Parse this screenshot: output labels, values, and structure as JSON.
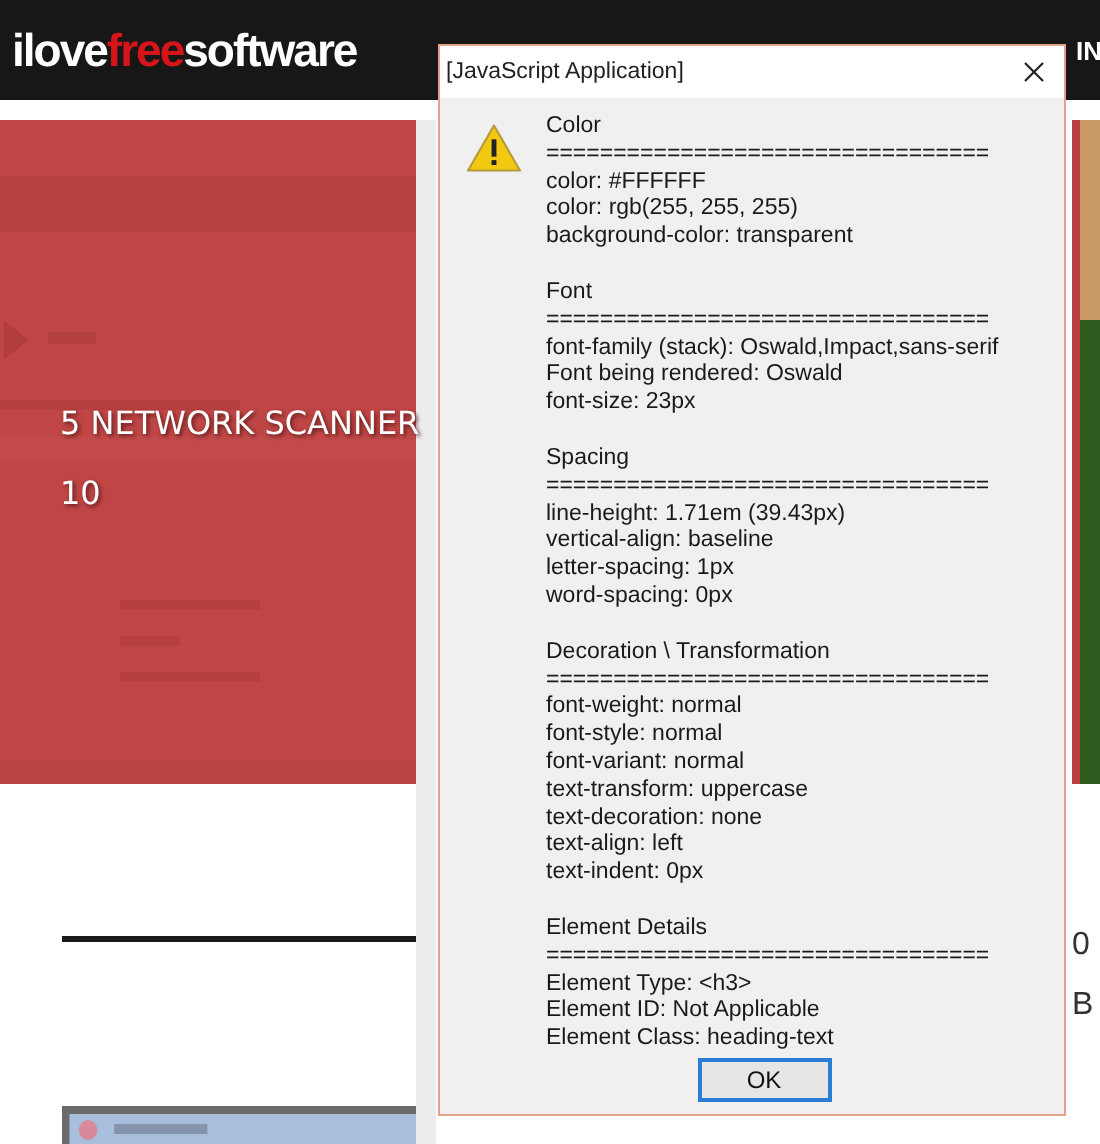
{
  "site_header": {
    "logo": [
      {
        "text": "ilove",
        "kind": "plain"
      },
      {
        "text": "free",
        "kind": "accent"
      },
      {
        "text": "software",
        "kind": "plain"
      }
    ],
    "nav_fragment": "IN"
  },
  "hero": {
    "kind": "picture",
    "heading_lines": [
      "5 NETWORK SCANNER",
      "10"
    ]
  },
  "side_fragments": [
    "0",
    "B"
  ],
  "dialog": {
    "title": "[JavaScript Application]",
    "sections": [
      {
        "heading": "Color",
        "rule": "=================================",
        "lines": [
          "color: #FFFFFF",
          "color: rgb(255, 255, 255)",
          "background-color: transparent"
        ]
      },
      {
        "heading": "Font",
        "rule": "=================================",
        "lines": [
          "font-family (stack): Oswald,Impact,sans-serif",
          "Font being rendered: Oswald",
          "font-size: 23px"
        ]
      },
      {
        "heading": "Spacing",
        "rule": "=================================",
        "lines": [
          "line-height: 1.71em (39.43px)",
          "vertical-align: baseline",
          "letter-spacing: 1px",
          "word-spacing: 0px"
        ]
      },
      {
        "heading": "Decoration \\ Transformation",
        "rule": "=================================",
        "lines": [
          "font-weight: normal",
          "font-style: normal",
          "font-variant: normal",
          "text-transform: uppercase",
          "text-decoration: none",
          "text-align: left",
          "text-indent: 0px"
        ]
      },
      {
        "heading": "Element Details",
        "rule": "=================================",
        "lines": [
          "Element Type: <h3>",
          "Element ID: Not Applicable",
          "Element Class: heading-text"
        ]
      }
    ],
    "button": "OK"
  }
}
